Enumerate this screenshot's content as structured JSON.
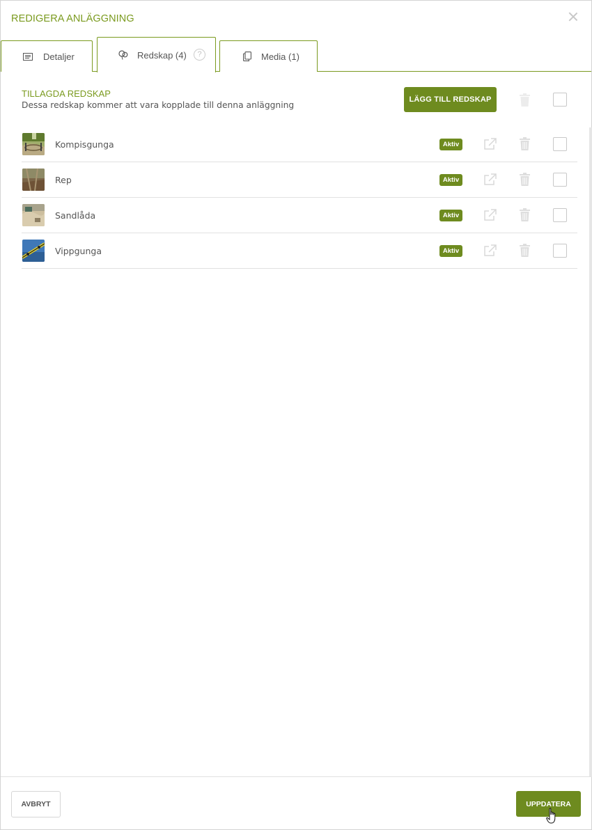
{
  "dialog": {
    "title": "REDIGERA ANLÄGGNING"
  },
  "tabs": [
    {
      "label": "Detaljer",
      "icon": "list-icon",
      "active": false
    },
    {
      "label": "Redskap (4)",
      "icon": "balloons-icon",
      "active": true,
      "help": "?"
    },
    {
      "label": "Media (1)",
      "icon": "copy-icon",
      "active": false
    }
  ],
  "section": {
    "title": "TILLAGDA REDSKAP",
    "subtitle": "Dessa redskap kommer att vara kopplade till denna anläggning",
    "add_button": "LÄGG TILL REDSKAP"
  },
  "equipment": [
    {
      "name": "Kompisgunga",
      "status": "Aktiv"
    },
    {
      "name": "Rep",
      "status": "Aktiv"
    },
    {
      "name": "Sandlåda",
      "status": "Aktiv"
    },
    {
      "name": "Vippgunga",
      "status": "Aktiv"
    }
  ],
  "footer": {
    "cancel": "AVBRYT",
    "update": "UPPDATERA"
  },
  "colors": {
    "accent": "#6e8b1f",
    "accent_text": "#7a9a1e"
  }
}
